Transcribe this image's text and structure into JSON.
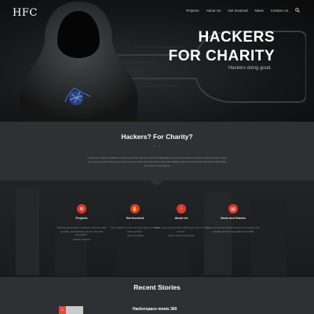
{
  "site": {
    "logo": "HFC"
  },
  "nav": {
    "items": [
      "Projects",
      "About Us",
      "Get Involved",
      "News",
      "Contact Us"
    ]
  },
  "hero": {
    "title_line1": "HACKERS",
    "title_line2": "FOR CHARITY",
    "subtitle": "Hackers doing good."
  },
  "intro": {
    "title": "Hackers? For Charity?",
    "dots": "• •",
    "text": "In general, a hacker is a skilled computer expert that uses their technical knowledge to overcome obstacles or problems. We are hackers, many of us security experts that use our superpowers to make the world a better place. We highlight projects and efforts and help fosters the hacking community on our pursuits."
  },
  "features": [
    {
      "title": "Projects",
      "quote": "\"Start by doing what's necessary; then do what's possible; and suddenly you are doing the impossible.\"",
      "author": "Francis of Assisi",
      "icon": "gears-icon"
    },
    {
      "title": "Get Involved",
      "quote": "\"The measure of who we are is what we do with what we have.\"",
      "author": "Vince Lombardi",
      "icon": "handshake-icon"
    },
    {
      "title": "About Us",
      "quote": "\"Even more important than what we do, there is who we are.\"",
      "author": "James Green (sr)(tm)(3x)",
      "icon": "info-icon"
    },
    {
      "title": "News and Stories",
      "quote": "Catch up with the hackers doing the necessary, the possible and the impossible since 2006",
      "author": "",
      "icon": "newspaper-icon"
    }
  ],
  "recent": {
    "title": "Recent Stories",
    "story_title": "Hackerspace meets 360",
    "badge": "2"
  },
  "colors": {
    "accent": "#d83a2d",
    "intro_bg": "#2e3033",
    "hero_bg": "#141516"
  }
}
